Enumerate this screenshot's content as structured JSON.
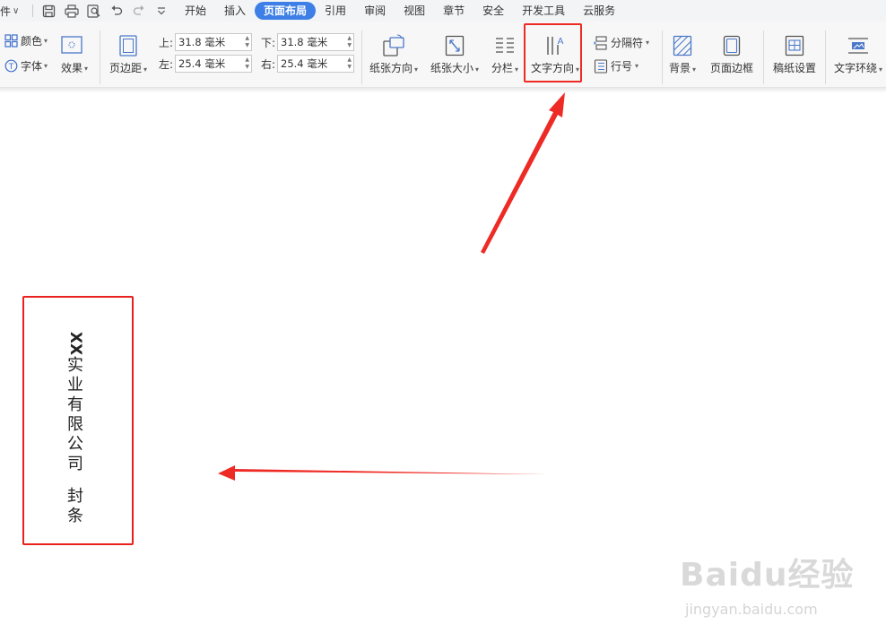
{
  "menubar": {
    "file_label": "件",
    "tabs": [
      "开始",
      "插入",
      "页面布局",
      "引用",
      "审阅",
      "视图",
      "章节",
      "安全",
      "开发工具",
      "云服务"
    ],
    "active_tab": "页面布局"
  },
  "ribbon": {
    "color_label": "颜色",
    "font_label": "字体",
    "effect_label": "效果",
    "margin_label": "页边距",
    "margins": {
      "top_label": "上:",
      "top_value": "31.8 毫米",
      "bottom_label": "下:",
      "bottom_value": "31.8 毫米",
      "left_label": "左:",
      "left_value": "25.4 毫米",
      "right_label": "右:",
      "right_value": "25.4 毫米"
    },
    "orientation_label": "纸张方向",
    "size_label": "纸张大小",
    "columns_label": "分栏",
    "text_direction_label": "文字方向",
    "separator_label": "分隔符",
    "line_number_label": "行号",
    "background_label": "背景",
    "page_border_label": "页面边框",
    "manuscript_label": "稿纸设置",
    "wrap_label": "文字环绕"
  },
  "document": {
    "vertical_text": [
      "XX",
      "实",
      "业",
      "有",
      "限",
      "公",
      "司",
      "",
      "封",
      "条"
    ]
  },
  "watermark": {
    "brand": "Baidu经验",
    "url": "jingyan.baidu.com"
  },
  "colors": {
    "accent": "#3d7fe6",
    "highlight": "#ee2a24"
  }
}
